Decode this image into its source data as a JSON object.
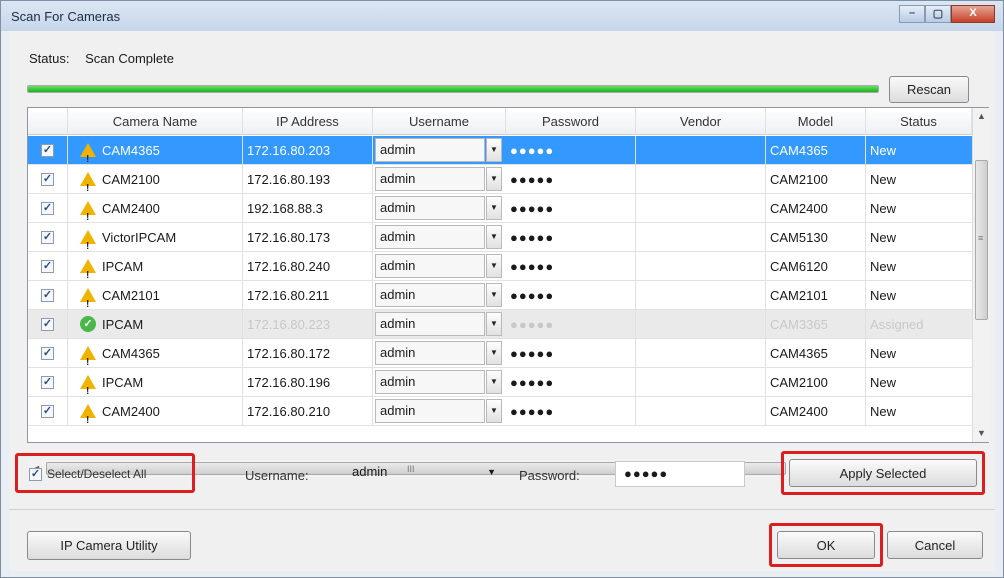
{
  "window": {
    "title": "Scan For Cameras",
    "minimize_glyph": "–",
    "maximize_glyph": "▢",
    "close_glyph": "X"
  },
  "status": {
    "label": "Status:",
    "value": "Scan Complete"
  },
  "progress": {
    "percent": 100,
    "color": "#15b515"
  },
  "rescan_label": "Rescan",
  "table": {
    "columns": [
      "Camera Name",
      "IP Address",
      "Username",
      "Password",
      "Vendor",
      "Model",
      "Status"
    ],
    "rows": [
      {
        "checked": true,
        "icon": "warning-icon",
        "name": "CAM4365",
        "ip": "172.16.80.203",
        "username": "admin",
        "password": "●●●●●",
        "vendor": "",
        "model": "CAM4365",
        "status": "New",
        "state": "selected"
      },
      {
        "checked": true,
        "icon": "warning-icon",
        "name": "CAM2100",
        "ip": "172.16.80.193",
        "username": "admin",
        "password": "●●●●●",
        "vendor": "",
        "model": "CAM2100",
        "status": "New",
        "state": "normal"
      },
      {
        "checked": true,
        "icon": "warning-icon",
        "name": "CAM2400",
        "ip": "192.168.88.3",
        "username": "admin",
        "password": "●●●●●",
        "vendor": "",
        "model": "CAM2400",
        "status": "New",
        "state": "normal"
      },
      {
        "checked": true,
        "icon": "warning-icon",
        "name": "VictorIPCAM",
        "ip": "172.16.80.173",
        "username": "admin",
        "password": "●●●●●",
        "vendor": "",
        "model": "CAM5130",
        "status": "New",
        "state": "normal"
      },
      {
        "checked": true,
        "icon": "warning-icon",
        "name": "IPCAM",
        "ip": "172.16.80.240",
        "username": "admin",
        "password": "●●●●●",
        "vendor": "",
        "model": "CAM6120",
        "status": "New",
        "state": "normal"
      },
      {
        "checked": true,
        "icon": "warning-icon",
        "name": "CAM2101",
        "ip": "172.16.80.211",
        "username": "admin",
        "password": "●●●●●",
        "vendor": "",
        "model": "CAM2101",
        "status": "New",
        "state": "normal"
      },
      {
        "checked": true,
        "icon": "check-circle-icon",
        "name": "IPCAM",
        "ip": "172.16.80.223",
        "username": "admin",
        "password": "●●●●●",
        "vendor": "",
        "model": "CAM3365",
        "status": "Assigned",
        "state": "assigned"
      },
      {
        "checked": true,
        "icon": "warning-icon",
        "name": "CAM4365",
        "ip": "172.16.80.172",
        "username": "admin",
        "password": "●●●●●",
        "vendor": "",
        "model": "CAM4365",
        "status": "New",
        "state": "normal"
      },
      {
        "checked": true,
        "icon": "warning-icon",
        "name": "IPCAM",
        "ip": "172.16.80.196",
        "username": "admin",
        "password": "●●●●●",
        "vendor": "",
        "model": "CAM2100",
        "status": "New",
        "state": "normal"
      },
      {
        "checked": true,
        "icon": "warning-icon",
        "name": "CAM2400",
        "ip": "172.16.80.210",
        "username": "admin",
        "password": "●●●●●",
        "vendor": "",
        "model": "CAM2400",
        "status": "New",
        "state": "normal"
      }
    ]
  },
  "scroll_arrows": {
    "up": "▲",
    "down": "▼",
    "left": "◄",
    "right": "►",
    "grip_v": "≡",
    "grip_h": "III"
  },
  "bottom": {
    "select_all_label": "Select/Deselect All",
    "select_all_checked": true,
    "username_label": "Username:",
    "username_value": "admin",
    "password_label": "Password:",
    "password_value": "●●●●●",
    "apply_label": "Apply Selected",
    "ip_utility_label": "IP Camera Utility",
    "ok_label": "OK",
    "cancel_label": "Cancel"
  },
  "colors": {
    "highlight": "#d91f1f",
    "selected_row": "#3399ff",
    "progress": "#15b515"
  }
}
